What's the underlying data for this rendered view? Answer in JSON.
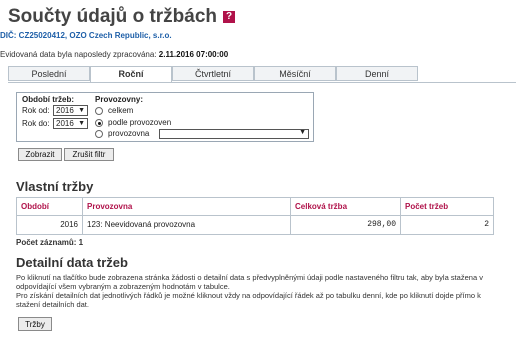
{
  "title": "Součty údajů o tržbách",
  "help_icon": "?",
  "company_line": "DIČ: CZ25020412, OZO Czech Republic, s.r.o.",
  "processed_label": "Evidovaná data byla naposledy zpracována:",
  "processed_value": "2.11.2016 07:00:00",
  "tabs": [
    {
      "label": "Poslední"
    },
    {
      "label": "Roční"
    },
    {
      "label": "Čtvrtletní"
    },
    {
      "label": "Měsíční"
    },
    {
      "label": "Denní"
    }
  ],
  "filter": {
    "period_label": "Období tržeb:",
    "year_from_label": "Rok od:",
    "year_from_value": "2016",
    "year_to_label": "Rok do:",
    "year_to_value": "2016",
    "prov_label": "Provozovny:",
    "options": [
      "celkem",
      "podle provozoven",
      "provozovna"
    ],
    "selected_option": "podle provozoven",
    "show_button": "Zobrazit",
    "cancel_button": "Zrušit filtr"
  },
  "summary": {
    "heading": "Vlastní tržby",
    "columns": [
      "Období",
      "Provozovna",
      "Celková tržba",
      "Počet tržeb"
    ],
    "rows": [
      {
        "period": "2016",
        "establishment": "123: Neevidovaná provozovna",
        "total": "298,00",
        "count": "2"
      }
    ],
    "record_count": "Počet záznamů: 1"
  },
  "details": {
    "heading": "Detailní data tržeb",
    "text1a": "Po kliknutí na tlačítko bude zobrazena stránka žádosti o detailní data s předvyplněnými údaji podle nastaveného filtru tak, aby byla stažena v",
    "text1b": "odpovídající všem vybraným a zobrazeným hodnotám v tabulce.",
    "text2a": "Pro získání detailních dat jednotlivých řádků je možné kliknout vždy na odpovídající řádek až po tabulku denní, kde po kliknutí dojde přímo k",
    "text2b": "stažení detailních dat.",
    "button": "Tržby"
  },
  "colors": {
    "accent": "#b0124a",
    "link": "#1e5fa8",
    "border": "#b9c3cc"
  }
}
